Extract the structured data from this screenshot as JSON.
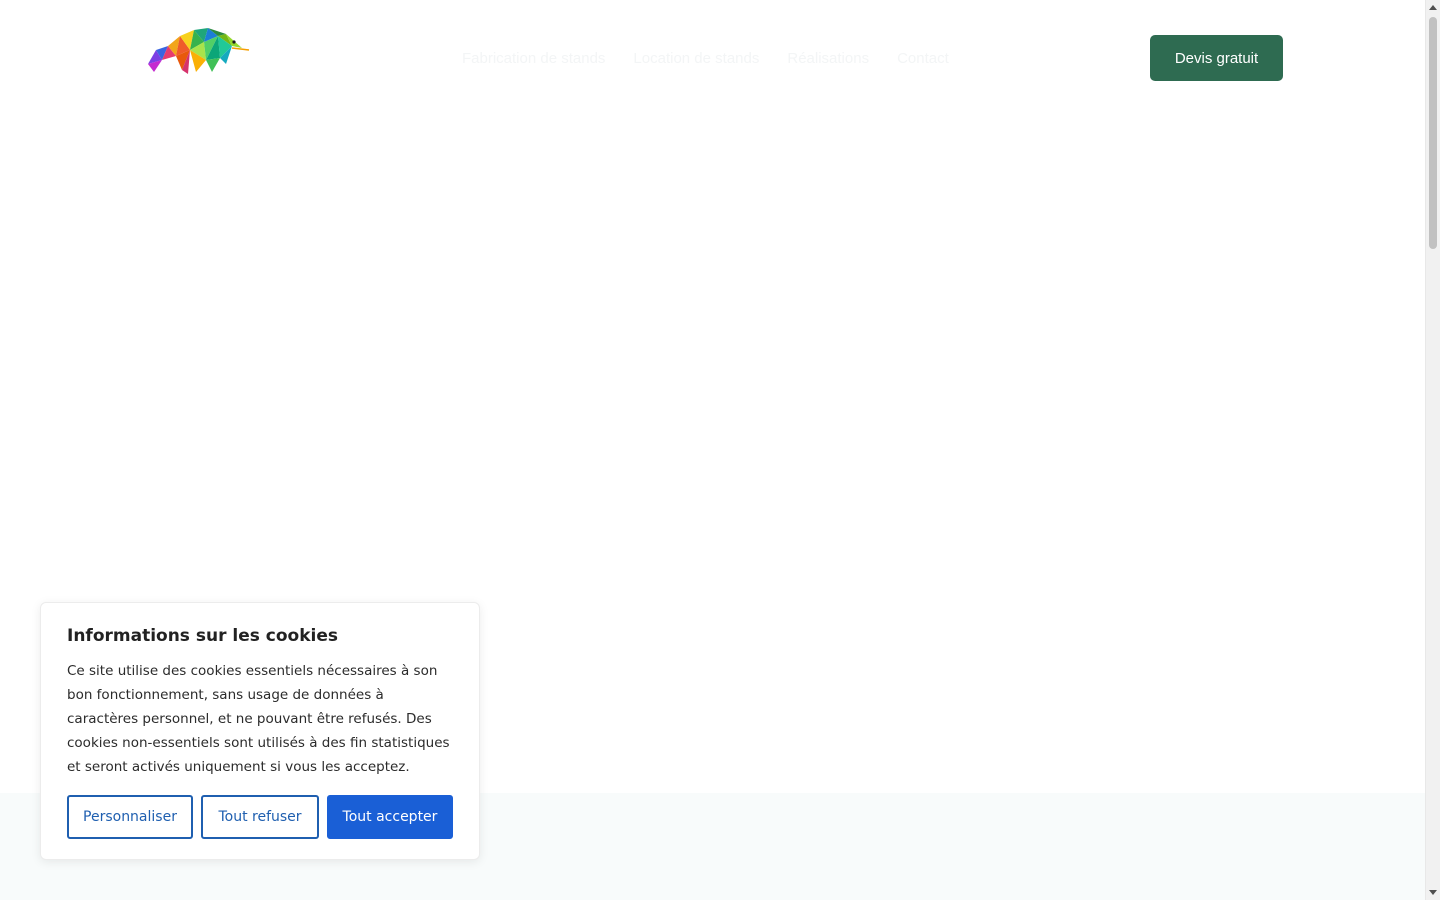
{
  "header": {
    "nav_items": [
      "Fabrication de stands",
      "Location de stands",
      "Réalisations",
      "Contact"
    ],
    "cta_label": "Devis gratuit"
  },
  "cookie_banner": {
    "title": "Informations sur les cookies",
    "body": "Ce site utilise des cookies essentiels nécessaires à son bon fonctionnement, sans usage de données à caractères personnel, et ne pouvant être refusés. Des cookies non-essentiels sont utilisés à des fin statistiques et seront activés uniquement si vous les acceptez.",
    "buttons": {
      "customize": "Personnaliser",
      "refuse_all": "Tout refuser",
      "accept_all": "Tout accepter"
    }
  },
  "colors": {
    "cta_background": "#2e6b51",
    "primary_button": "#1a5fd6",
    "outline_button": "#1f5fb0"
  },
  "icons": {
    "logo": "chameleon-logo"
  }
}
